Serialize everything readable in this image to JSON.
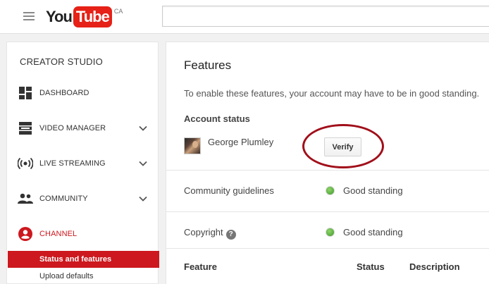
{
  "header": {
    "logo_you": "You",
    "logo_tube": "Tube",
    "logo_region": "CA",
    "search_placeholder": ""
  },
  "sidebar": {
    "heading": "CREATOR STUDIO",
    "items": [
      {
        "label": "DASHBOARD",
        "icon": "dashboard-icon",
        "expandable": false
      },
      {
        "label": "VIDEO MANAGER",
        "icon": "video-manager-icon",
        "expandable": true
      },
      {
        "label": "LIVE STREAMING",
        "icon": "live-streaming-icon",
        "expandable": true
      },
      {
        "label": "COMMUNITY",
        "icon": "community-icon",
        "expandable": true
      },
      {
        "label": "CHANNEL",
        "icon": "channel-icon",
        "expandable": false,
        "active": true
      }
    ],
    "sub_items": [
      {
        "label": "Status and features",
        "selected": true
      },
      {
        "label": "Upload defaults",
        "selected": false
      }
    ]
  },
  "main": {
    "title": "Features",
    "intro": "To enable these features, your account may have to be in good standing.",
    "account_status_title": "Account status",
    "username": "George Plumley",
    "verify_label": "Verify",
    "rows": [
      {
        "label": "Community guidelines",
        "status": "Good standing",
        "help": false
      },
      {
        "label": "Copyright",
        "status": "Good standing",
        "help": true
      }
    ],
    "table_headers": [
      "Feature",
      "Status",
      "Description"
    ]
  },
  "colors": {
    "brand_red": "#e62117",
    "active_red": "#cc181e",
    "annotation_circle": "#a10f1a",
    "status_green": "#5cb63f"
  }
}
